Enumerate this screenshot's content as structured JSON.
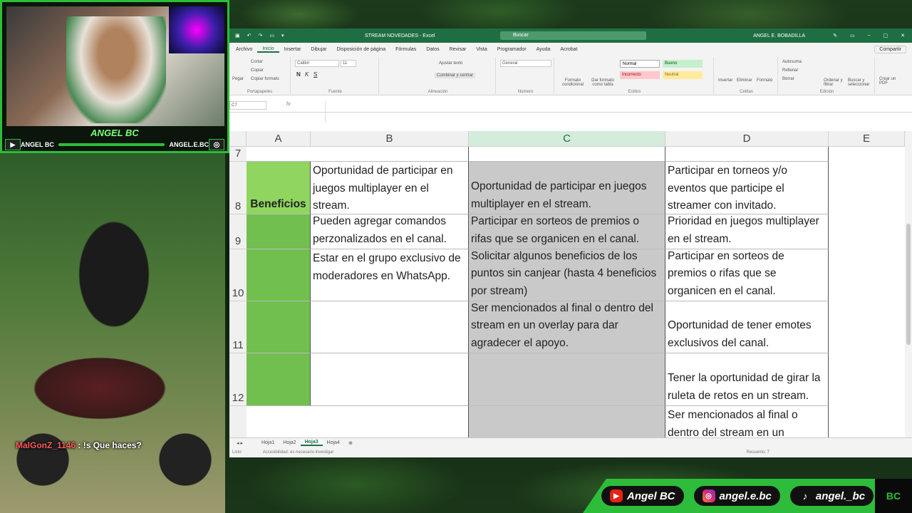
{
  "webcam": {
    "name": "ANGEL BC",
    "left_handle": "ANGEL BC",
    "right_handle": "ANGEL.E.BC"
  },
  "chat": {
    "user": "MalGonZ_1146",
    "separator": " : ",
    "message": "!s Que haces?"
  },
  "excel": {
    "title": "STREAM NOVEDADES  -  Excel",
    "search_placeholder": "Buscar",
    "user": "ANGEL E. BOBADILLA",
    "menu": [
      "Archivo",
      "Inicio",
      "Insertar",
      "Dibujar",
      "Disposición de página",
      "Fórmulas",
      "Datos",
      "Revisar",
      "Vista",
      "Programador",
      "Ayuda",
      "Acrobat"
    ],
    "share": "Compartir",
    "ribbon": {
      "paste": "Pegar",
      "cut": "Cortar",
      "copy": "Copiar",
      "format_painter": "Copiar formato",
      "clipboard": "Portapapeles",
      "font_name": "Calibri",
      "font_size": "11",
      "font_group": "Fuente",
      "wrap_text": "Ajustar texto",
      "merge_center": "Combinar y centrar",
      "alignment": "Alineación",
      "number_format": "General",
      "number": "Número",
      "cond_format": "Formato condicional",
      "format_table": "Dar formato como tabla",
      "styles": {
        "normal": "Normal",
        "bueno": "Bueno",
        "incorrecto": "Incorrecto",
        "neutral": "Neutral"
      },
      "styles_group": "Estilos",
      "insert": "Insertar",
      "delete": "Eliminar",
      "format": "Formato",
      "cells_group": "Celdas",
      "autosum": "Autosuma",
      "fill": "Rellenar",
      "clear": "Borrar",
      "sort_filter": "Ordenar y filtrar",
      "find_select": "Buscar y seleccionar",
      "editing_group": "Edición",
      "create_pdf": "Crear un PDF"
    },
    "namebox": "C7",
    "columns": [
      "A",
      "B",
      "C",
      "D",
      "E"
    ],
    "rows": [
      {
        "num": "7",
        "a": "",
        "b": "",
        "c": "",
        "d": ""
      },
      {
        "num": "8",
        "a": "Beneficios",
        "b": "Oportunidad de participar en juegos multiplayer en el stream.",
        "c": "Oportunidad de participar en juegos multiplayer en el stream.",
        "d": "Participar en torneos y/o eventos que participe el streamer con invitado."
      },
      {
        "num": "9",
        "a": "",
        "b": "Pueden agregar comandos perzonalizados en el canal.",
        "c": "Participar en sorteos de premios o rifas que se organicen en el canal.",
        "d": "Prioridad en juegos multiplayer en el stream."
      },
      {
        "num": "10",
        "a": "",
        "b": "Estar en el grupo exclusivo de moderadores en WhatsApp.",
        "c": "Solicitar algunos beneficios de los puntos sin canjear (hasta 4 beneficios por stream)",
        "d": "Participar en sorteos de premios o rifas que se organicen en el canal."
      },
      {
        "num": "11",
        "a": "",
        "b": "",
        "c": "Ser mencionados al final o dentro del stream en un overlay para dar agradecer el apoyo.",
        "d": "Oportunidad de tener emotes exclusivos del canal."
      },
      {
        "num": "12",
        "a": "",
        "b": "",
        "c": "",
        "d": "Tener la oportunidad de girar la ruleta de retos en un stream."
      },
      {
        "num": "",
        "a": "",
        "b": "",
        "c": "",
        "d": "Ser mencionados al final o dentro del stream en un"
      }
    ],
    "sheets": [
      "Hoja1",
      "Hoja2",
      "Hoja3",
      "Hoja4"
    ],
    "active_sheet": "Hoja3",
    "status": "Listo",
    "accessibility": "Accesibilidad: es necesario investigar",
    "zoom": "Recuento: 7"
  },
  "socials": {
    "youtube": "Angel BC",
    "instagram": "angel.e.bc",
    "tiktok": "angel._bc"
  },
  "logo_text": "BC"
}
